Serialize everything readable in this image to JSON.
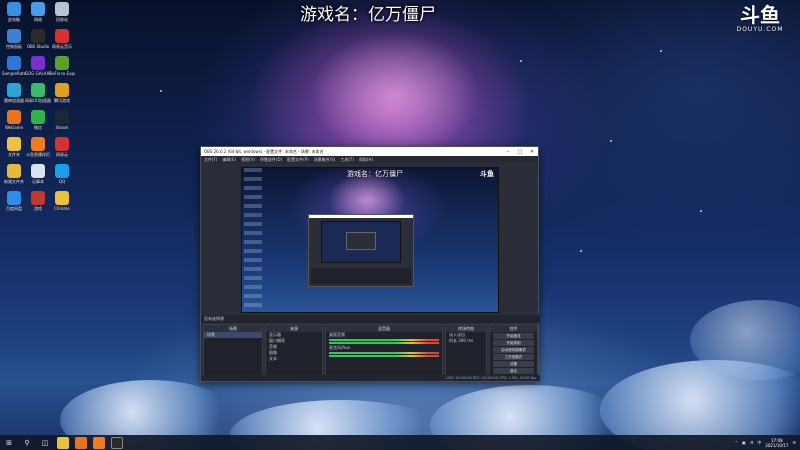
{
  "overlay": {
    "stream_title": "游戏名：亿万僵尸",
    "logo_mark": "斗鱼",
    "logo_sub": "DOUYU.COM"
  },
  "desktop": {
    "icons": [
      {
        "label": "此电脑",
        "icon": "computer-icon",
        "color": "#3a8ee6"
      },
      {
        "label": "网络",
        "icon": "network-icon",
        "color": "#4a9be8"
      },
      {
        "label": "回收站",
        "icon": "recycle-bin-icon",
        "color": "#b7c3d6"
      },
      {
        "label": "控制面板",
        "icon": "control-panel-icon",
        "color": "#3f7fd0"
      },
      {
        "label": "OBS Studio",
        "icon": "obs-icon",
        "color": "#2a2a2a"
      },
      {
        "label": "网易云音乐",
        "icon": "music-icon",
        "color": "#d63031"
      },
      {
        "label": "SampleRate",
        "icon": "app-icon",
        "color": "#2f77d6"
      },
      {
        "label": "GOG GALAXY",
        "icon": "gog-icon",
        "color": "#7a2fd0"
      },
      {
        "label": "GeForce Experience",
        "icon": "geforce-icon",
        "color": "#5aa02c"
      },
      {
        "label": "雷神加速器",
        "icon": "accelerator-icon",
        "color": "#2fa3d6"
      },
      {
        "label": "网易UU加速器",
        "icon": "uu-icon",
        "color": "#3cba6a"
      },
      {
        "label": "腾讯游戏",
        "icon": "tencent-icon",
        "color": "#e0a020"
      },
      {
        "label": "WeGame",
        "icon": "wegame-icon",
        "color": "#e8741c"
      },
      {
        "label": "微信",
        "icon": "wechat-icon",
        "color": "#2fb34a"
      },
      {
        "label": "Steam",
        "icon": "steam-icon",
        "color": "#1b2838"
      },
      {
        "label": "文件夹",
        "icon": "folder-icon",
        "color": "#f0c040"
      },
      {
        "label": "斗鱼直播伴侣",
        "icon": "douyu-icon",
        "color": "#f47a20"
      },
      {
        "label": "网易云",
        "icon": "netease-icon",
        "color": "#d63031"
      },
      {
        "label": "新建文件夹",
        "icon": "folder-icon",
        "color": "#e8b838"
      },
      {
        "label": "记事本",
        "icon": "notepad-icon",
        "color": "#d8e4f0"
      },
      {
        "label": "QQ",
        "icon": "qq-icon",
        "color": "#1aa0e8"
      },
      {
        "label": "百度网盘",
        "icon": "cloud-drive-icon",
        "color": "#2f8fe6"
      },
      {
        "label": "游戏",
        "icon": "game-icon",
        "color": "#c0392b"
      },
      {
        "label": "Chrome",
        "icon": "chrome-icon",
        "color": "#e8c33a"
      }
    ]
  },
  "obs": {
    "title": "OBS 26.0.2 (64-bit, windows) - 配置文件: 未命名 - 场景: 未命名",
    "menu": [
      "文件(F)",
      "编辑(E)",
      "视图(V)",
      "停靠部件(D)",
      "配置文件(P)",
      "场景集合(S)",
      "工具(T)",
      "帮助(H)"
    ],
    "scene_strip": "没有选择源",
    "docks": {
      "scenes_title": "场景",
      "scenes": [
        "场景"
      ],
      "sources_title": "来源",
      "sources": [
        "显示器",
        "窗口捕获",
        "音频",
        "图像",
        "文本"
      ],
      "mixer_title": "混音器",
      "mixer_channels": [
        "桌面音频",
        "麦克风/Aux"
      ],
      "transitions_title": "转场特效",
      "transition_value": "淡入淡出",
      "duration_label": "时长",
      "duration_value": "300 ms",
      "controls_title": "控件",
      "controls": [
        "开始推流",
        "开始录制",
        "启动虚拟摄像机",
        "工作室模式",
        "设置",
        "退出"
      ]
    },
    "status": "LIVE: 00:00:00   REC: 00:00:00   CPU: 1.9%, 30.00 fps"
  },
  "taskbar": {
    "time": "17:08",
    "date": "2021/10/17",
    "lang": "中"
  }
}
